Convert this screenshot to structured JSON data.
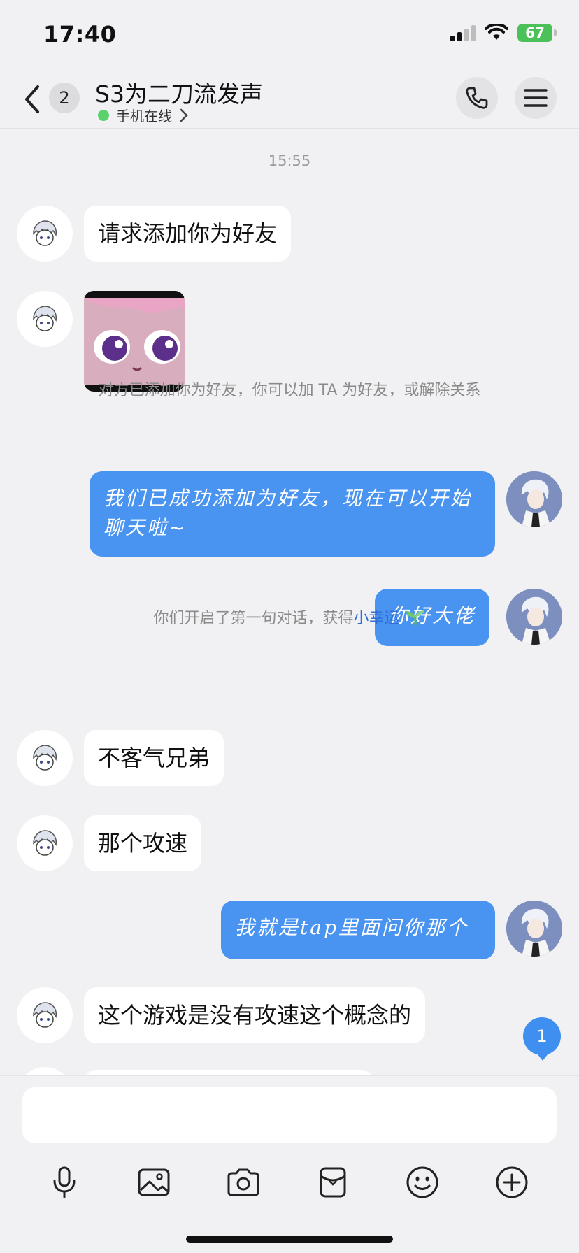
{
  "status": {
    "time": "17:40",
    "battery": "67"
  },
  "header": {
    "unread_count": "2",
    "title": "S3为二刀流发声",
    "subtitle": "手机在线"
  },
  "messages": {
    "time_label": "15:55",
    "m1": "请求添加你为好友",
    "sys1": "对方已添加你为好友，你可以加 TA 为好友，或解除关系",
    "m2": "我们已成功添加为好友，现在可以开始聊天啦~",
    "m3": "你好大佬",
    "sys2_prefix": "你们开启了第一句对话，获得",
    "sys2_link": "小幸运",
    "m4": "不客气兄弟",
    "m5": "那个攻速",
    "m6": "我就是tap里面问你那个",
    "m7": "这个游戏是没有攻速这个概念的"
  },
  "new_message_count": "1",
  "input": {
    "placeholder": ""
  },
  "toolbar": [
    "mic-icon",
    "image-icon",
    "camera-icon",
    "red-packet-icon",
    "emoji-icon",
    "plus-icon"
  ],
  "colors": {
    "accent": "#4993f1",
    "online": "#5ad26b",
    "battery": "#4cc15a"
  }
}
